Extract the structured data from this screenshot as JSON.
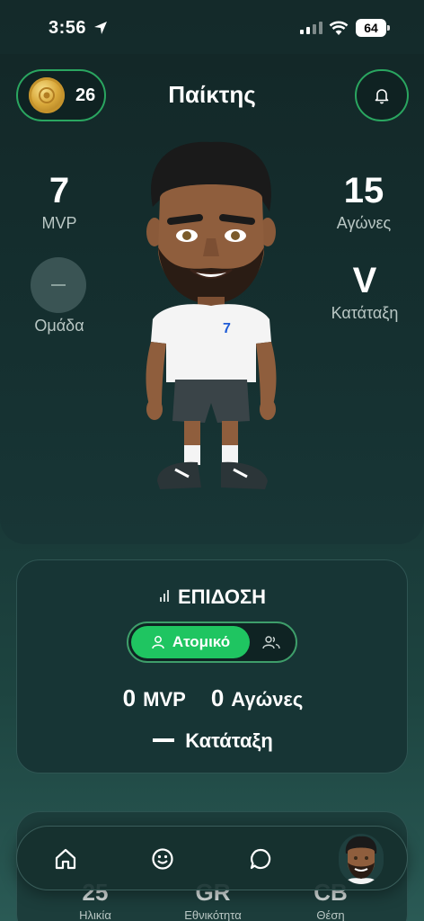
{
  "status_bar": {
    "time": "3:56",
    "battery": "64"
  },
  "header": {
    "coins": "26",
    "title": "Παίκτης"
  },
  "stats": {
    "mvp": {
      "value": "7",
      "label": "MVP"
    },
    "matches": {
      "value": "15",
      "label": "Αγώνες"
    },
    "team": {
      "label": "Ομάδα"
    },
    "rank": {
      "value": "V",
      "label": "Κατάταξη"
    }
  },
  "avatar": {
    "jersey_number": "7"
  },
  "performance": {
    "title": "ΕΠΙΔΟΣΗ",
    "toggle_active": "Ατομικό",
    "mvp_count": "0",
    "mvp_label": "MVP",
    "matches_count": "0",
    "matches_label": "Αγώνες",
    "rank_label": "Κατάταξη"
  },
  "info": {
    "age": {
      "value": "25",
      "label": "Ηλικία"
    },
    "nationality": {
      "value": "GR",
      "label": "Εθνικότητα"
    },
    "position": {
      "value": "CB",
      "label": "Θέση"
    }
  },
  "nav": {
    "items": [
      "home-icon",
      "smiley-icon",
      "chat-icon",
      "profile-avatar"
    ]
  },
  "colors": {
    "accent": "#1fc561",
    "border_accent": "#2aa660",
    "background": "#173333"
  }
}
